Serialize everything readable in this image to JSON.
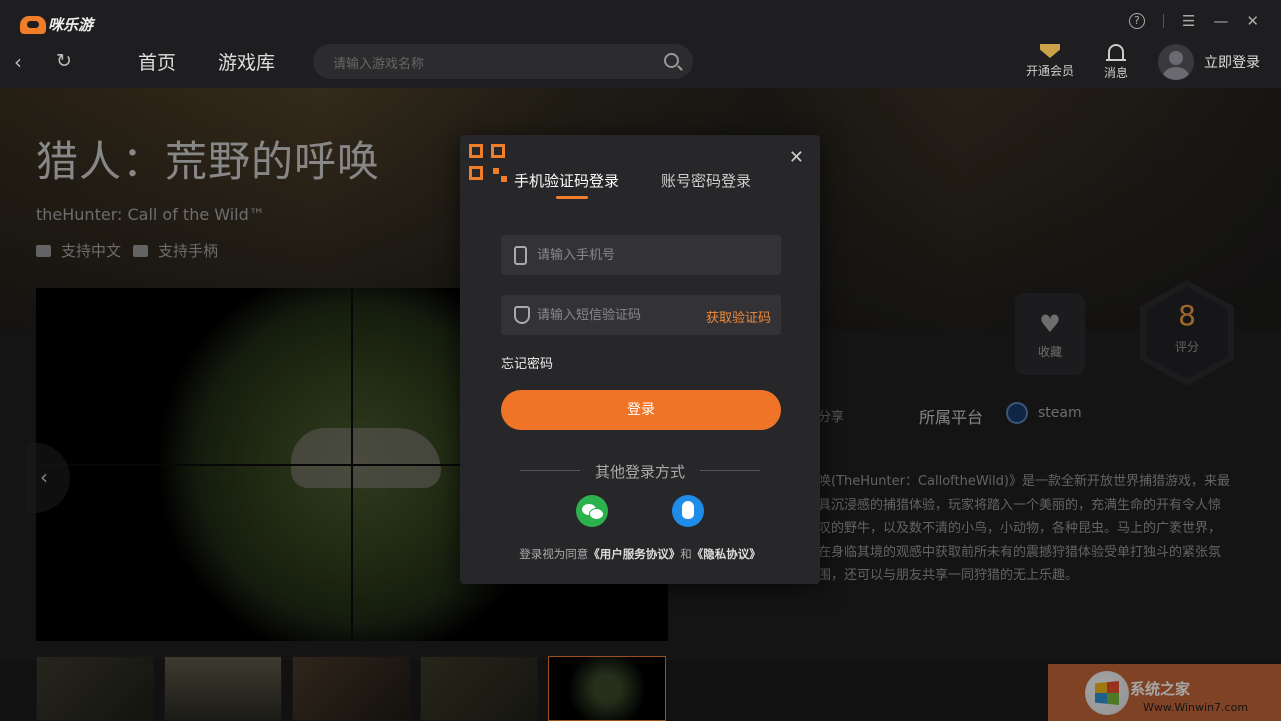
{
  "app": {
    "name": "咪乐游"
  },
  "nav": {
    "home": "首页",
    "library": "游戏库"
  },
  "search": {
    "placeholder": "请输入游戏名称"
  },
  "top_right": {
    "vip": "开通会员",
    "messages": "消息",
    "login": "立即登录"
  },
  "window_controls": {
    "help": "?",
    "menu": "☰",
    "minimize": "—",
    "close": "✕"
  },
  "game": {
    "title": "猎人：荒野的呼唤",
    "subtitle": "theHunter: Call of the Wild™",
    "tag_chinese": "支持中文",
    "tag_gamepad": "支持手柄",
    "favorite_label": "收藏",
    "score": "8",
    "score_label": "评分",
    "share": "分享",
    "platform_label": "所属平台",
    "platform": "steam",
    "description": "唤(TheHunter：CalloftheWild)》是一款全新开放世界捕猎游戏，来最具沉浸感的捕猎体验，玩家将踏入一个美丽的，充满生命的开有令人惊叹的野牛，以及数不清的小鸟，小动物，各种昆虫。马上的广袤世界，在身临其境的观感中获取前所未有的震撼狩猎体验受单打独斗的紧张氛围，还可以与朋友共享一同狩猎的无上乐趣。"
  },
  "login_modal": {
    "tab_sms": "手机验证码登录",
    "tab_password": "账号密码登录",
    "phone_placeholder": "请输入手机号",
    "code_placeholder": "请输入短信验证码",
    "get_code": "获取验证码",
    "forgot": "忘记密码",
    "login_button": "登录",
    "other_methods": "其他登录方式",
    "agree_prefix": "登录视为同意",
    "agree_terms": "《用户服务协议》",
    "agree_and": "和",
    "agree_privacy": "《隐私协议》"
  },
  "watermark": {
    "text": "系统之家",
    "url": "Www.Winwin7.com"
  },
  "colors": {
    "accent": "#f07428",
    "background": "#1e1e20",
    "modal": "#27272a"
  }
}
